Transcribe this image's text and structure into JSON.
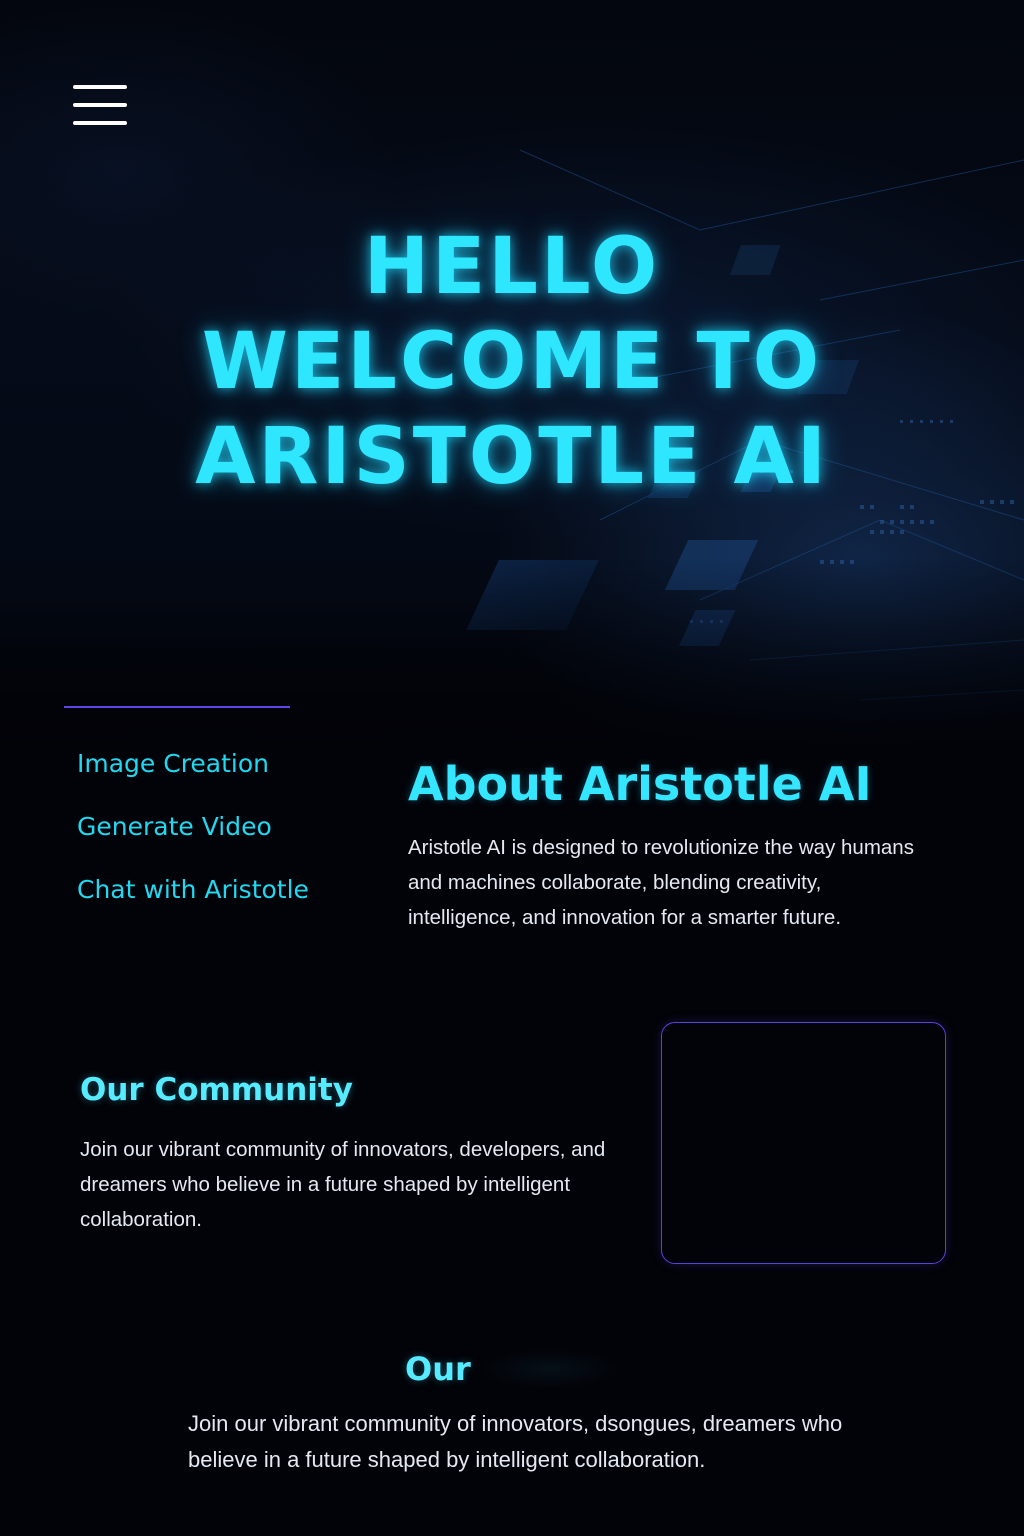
{
  "header": {
    "menu_icon": "hamburger-menu-icon"
  },
  "hero": {
    "title_lines": [
      "HELLO",
      "WELCOME TO",
      "ARISTOTLE AI"
    ],
    "accent_color": "#2ee7ff",
    "background": "circuit-board"
  },
  "nav": {
    "items": [
      {
        "label": "Image Creation"
      },
      {
        "label": "Generate Video"
      },
      {
        "label": "Chat with Aristotle"
      }
    ]
  },
  "about": {
    "title": "About Aristotle AI",
    "body": "Aristotle AI is designed to revolutionize the way humans and machines collaborate, blending creativity, intelligence, and innovation for a smarter future."
  },
  "community": {
    "title": "Our Community",
    "body": "Join our vibrant community of innovators, developers, and dreamers who believe in a future shaped by intelligent collaboration.",
    "frame_border_color": "#5a3fe0"
  },
  "bottom": {
    "title": "Our",
    "body": "Join our vibrant community of innovators,  dsongues, dreamers who believe in a future shaped by intelligent collaboration."
  },
  "colors": {
    "background": "#020308",
    "accent": "#2ee7ff",
    "divider": "#5b47e8"
  }
}
